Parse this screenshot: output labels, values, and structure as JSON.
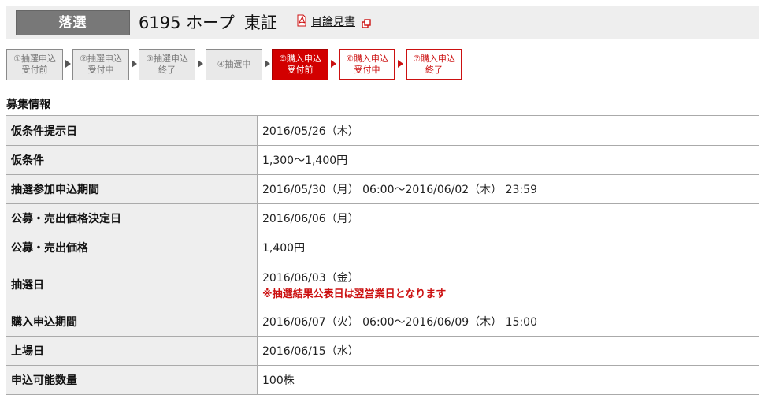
{
  "header": {
    "status_badge": "落選",
    "code": "6195",
    "company": "ホープ",
    "market": "東証",
    "prospectus_link": "目論見書",
    "pdf_icon": "pdf-icon",
    "external_icon": "external-window-icon"
  },
  "steps": [
    {
      "label": "①抽選申込\n受付前",
      "state": "done"
    },
    {
      "label": "②抽選申込\n受付中",
      "state": "done"
    },
    {
      "label": "③抽選申込\n終了",
      "state": "done"
    },
    {
      "label": "④抽選中",
      "state": "done"
    },
    {
      "label": "⑤購入申込\n受付前",
      "state": "active"
    },
    {
      "label": "⑥購入申込\n受付中",
      "state": "future"
    },
    {
      "label": "⑦購入申込\n終了",
      "state": "future"
    }
  ],
  "section": {
    "title": "募集情報"
  },
  "rows": [
    {
      "label": "仮条件提示日",
      "value": "2016/05/26（木）"
    },
    {
      "label": "仮条件",
      "value": "1,300〜1,400円"
    },
    {
      "label": "抽選参加申込期間",
      "value": "2016/05/30（月） 06:00〜2016/06/02（木） 23:59"
    },
    {
      "label": "公募・売出価格決定日",
      "value": "2016/06/06（月）"
    },
    {
      "label": "公募・売出価格",
      "value": "1,400円"
    },
    {
      "label": "抽選日",
      "value": "2016/06/03（金）",
      "note": "※抽選結果公表日は翌営業日となります"
    },
    {
      "label": "購入申込期間",
      "value": "2016/06/07（火） 06:00〜2016/06/09（木） 15:00"
    },
    {
      "label": "上場日",
      "value": "2016/06/15（水）"
    },
    {
      "label": "申込可能数量",
      "value": "100株"
    }
  ],
  "colors": {
    "accent_red": "#d20000",
    "badge_gray": "#787878"
  }
}
